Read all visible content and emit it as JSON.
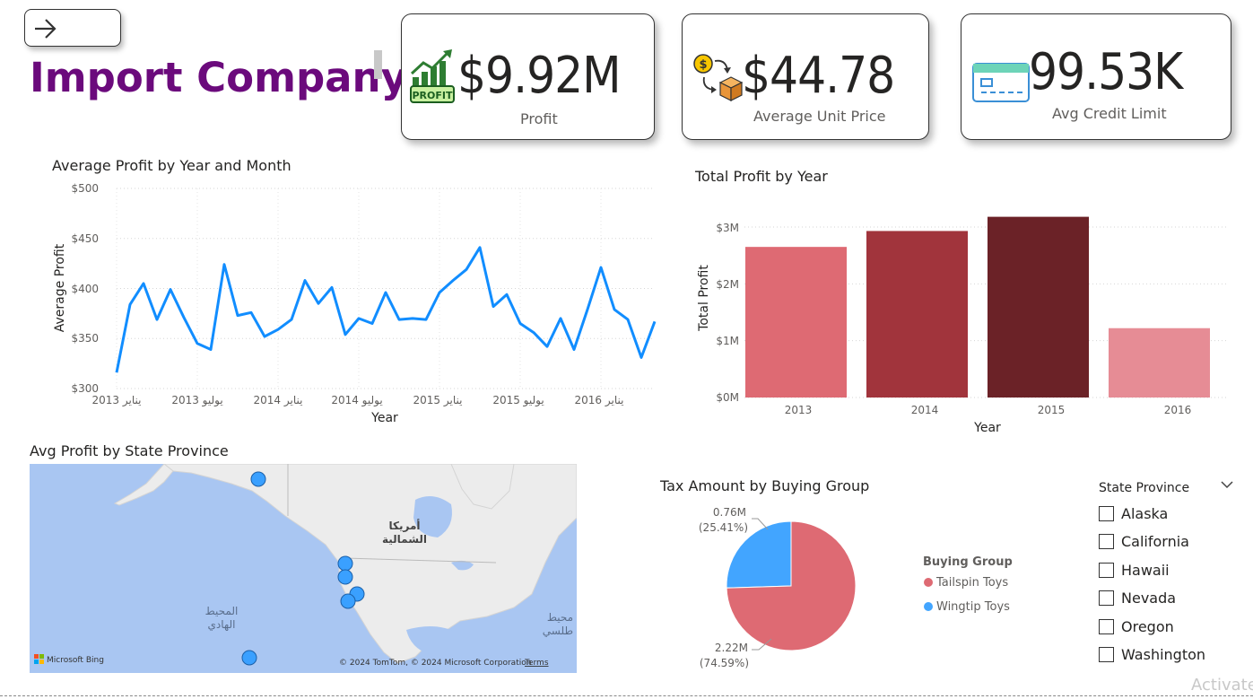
{
  "header": {
    "title": "Import Company",
    "back_icon": "arrow-right-icon"
  },
  "cards": [
    {
      "value": "$9.92M",
      "label": "Profit",
      "icon": "profit-growth-icon"
    },
    {
      "value": "$44.78",
      "label": "Average Unit Price",
      "icon": "coin-box-exchange-icon"
    },
    {
      "value": "99.53K",
      "label": "Avg Credit Limit",
      "icon": "credit-card-icon"
    }
  ],
  "line_chart": {
    "title": "Average Profit by Year and Month",
    "xlabel": "Year",
    "ylabel": "Average Profit",
    "y_ticks": [
      "$500",
      "$450",
      "$400",
      "$350",
      "$300"
    ],
    "x_ticks": [
      "2013 يناير",
      "2013 يوليو",
      "2014 يناير",
      "2014 يوليو",
      "2015 يناير",
      "2015 يوليو",
      "2016 يناير"
    ],
    "color": "#118DFF"
  },
  "bar_chart": {
    "title": "Total Profit by Year",
    "xlabel": "Year",
    "ylabel": "Total Profit",
    "y_ticks": [
      "$3M",
      "$2M",
      "$1M",
      "$0M"
    ],
    "categories": [
      "2013",
      "2014",
      "2015",
      "2016"
    ],
    "colors": [
      "#de6a73",
      "#a1343c",
      "#6b2227",
      "#e68c95"
    ]
  },
  "map": {
    "title": "Avg Profit by State Province",
    "label_continent": [
      "أمريكا",
      "الشمالية"
    ],
    "label_pacific": [
      "المحيط",
      "الهادي"
    ],
    "label_atlantic": [
      "محيط",
      "طلسي"
    ],
    "credit": "© 2024 TomTom, © 2024 Microsoft Corporation",
    "terms": "Terms",
    "bing": "Microsoft Bing",
    "point_color": "#3aa0ff"
  },
  "pie_chart": {
    "title": "Tax Amount by Buying Group",
    "legend_title": "Buying Group",
    "label_small_value": "0.76M",
    "label_small_pct": "(25.41%)",
    "label_large_value": "2.22M",
    "label_large_pct": "(74.59%)",
    "legend": [
      {
        "name": "Tailspin Toys",
        "color": "#de6a73"
      },
      {
        "name": "Wingtip Toys",
        "color": "#42a5ff"
      }
    ]
  },
  "slicer": {
    "title": "State Province",
    "items": [
      "Alaska",
      "California",
      "Hawaii",
      "Nevada",
      "Oregon",
      "Washington"
    ]
  },
  "watermark": "Activate",
  "chart_data": [
    {
      "type": "line",
      "title": "Average Profit by Year and Month",
      "xlabel": "Year",
      "ylabel": "Average Profit",
      "ylim": [
        300,
        500
      ],
      "x": [
        "2013-01",
        "2013-02",
        "2013-03",
        "2013-04",
        "2013-05",
        "2013-06",
        "2013-07",
        "2013-08",
        "2013-09",
        "2013-10",
        "2013-11",
        "2013-12",
        "2014-01",
        "2014-02",
        "2014-03",
        "2014-04",
        "2014-05",
        "2014-06",
        "2014-07",
        "2014-08",
        "2014-09",
        "2014-10",
        "2014-11",
        "2014-12",
        "2015-01",
        "2015-02",
        "2015-03",
        "2015-04",
        "2015-05",
        "2015-06",
        "2015-07",
        "2015-08",
        "2015-09",
        "2015-10",
        "2015-11",
        "2015-12",
        "2016-01",
        "2016-02",
        "2016-03",
        "2016-04",
        "2016-05"
      ],
      "values": [
        316,
        384,
        405,
        369,
        399,
        371,
        345,
        339,
        424,
        373,
        376,
        352,
        359,
        369,
        408,
        385,
        401,
        354,
        370,
        365,
        396,
        369,
        370,
        369,
        396,
        408,
        419,
        441,
        382,
        394,
        365,
        356,
        342,
        370,
        339,
        379,
        421,
        379,
        369,
        331,
        367
      ]
    },
    {
      "type": "bar",
      "title": "Total Profit by Year",
      "xlabel": "Year",
      "ylabel": "Total Profit",
      "categories": [
        "2013",
        "2014",
        "2015",
        "2016"
      ],
      "values": [
        2.65,
        2.93,
        3.18,
        1.22
      ],
      "unit": "$M",
      "ylim": [
        0,
        3.5
      ]
    },
    {
      "type": "pie",
      "title": "Tax Amount by Buying Group",
      "categories": [
        "Tailspin Toys",
        "Wingtip Toys"
      ],
      "values": [
        2.22,
        0.76
      ],
      "percent": [
        74.59,
        25.41
      ]
    }
  ]
}
